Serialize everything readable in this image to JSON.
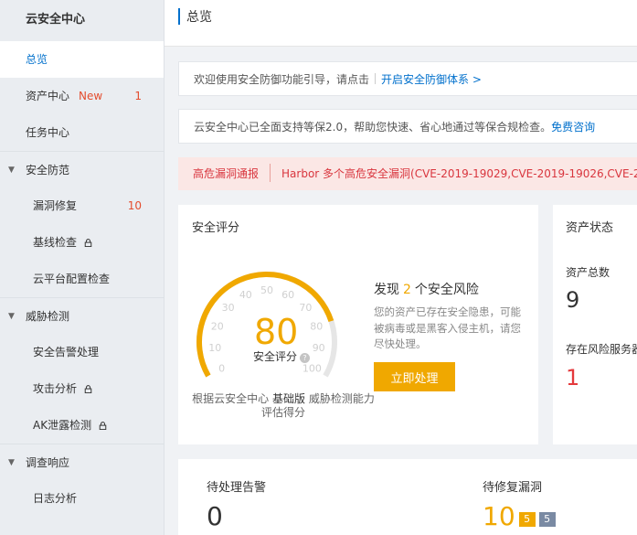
{
  "sidebar": {
    "title": "云安全中心",
    "items": [
      {
        "label": "总览"
      },
      {
        "label": "资产中心",
        "badge": "New",
        "count": "1"
      },
      {
        "label": "任务中心"
      }
    ],
    "groups": [
      {
        "label": "安全防范",
        "items": [
          {
            "label": "漏洞修复",
            "count": "10"
          },
          {
            "label": "基线检查",
            "locked": true
          },
          {
            "label": "云平台配置检查"
          }
        ]
      },
      {
        "label": "威胁检测",
        "items": [
          {
            "label": "安全告警处理"
          },
          {
            "label": "攻击分析",
            "locked": true
          },
          {
            "label": "AK泄露检测",
            "locked": true
          }
        ]
      },
      {
        "label": "调查响应",
        "items": [
          {
            "label": "日志分析"
          }
        ]
      }
    ]
  },
  "header": {
    "title": "总览"
  },
  "notices": {
    "guide_text": "欢迎使用安全防御功能引导，请点击",
    "guide_link": "开启安全防御体系 >",
    "compliance_text": "云安全中心已全面支持等保2.0，帮助您快速、省心地通过等保合规检查。",
    "compliance_link": "免费咨询"
  },
  "alert": {
    "tag": "高危漏洞通报",
    "text": "Harbor 多个高危安全漏洞(CVE-2019-19029,CVE-2019-19026,CVE-2019-"
  },
  "security_score": {
    "title": "安全评分",
    "score": "80",
    "score_label": "安全评分",
    "ticks": [
      "0",
      "10",
      "20",
      "30",
      "40",
      "50",
      "60",
      "70",
      "80",
      "90",
      "100"
    ],
    "desc_prefix": "根据云安全中心",
    "desc_edition": "基础版",
    "desc_suffix": "威胁检测能力",
    "desc_line2": "评估得分",
    "risk_prefix": "发现",
    "risk_count": "2",
    "risk_suffix": "个安全风险",
    "risk_desc": "您的资产已存在安全隐患，可能被病毒或是黑客入侵主机，请您尽快处理。",
    "action_label": "立即处理",
    "colors": {
      "accent": "#f0a800",
      "track": "#e6e6e6"
    }
  },
  "asset_status": {
    "title": "资产状态",
    "total_label": "资产总数",
    "total_value": "9",
    "risk_label": "存在风险服务器",
    "risk_value": "1",
    "colors": {
      "risk": "#e4393c"
    }
  },
  "bottom": {
    "alerts_label": "待处理告警",
    "alerts_value": "0",
    "vulns_label": "待修复漏洞",
    "vulns_value": "10",
    "vulns_high": "5",
    "vulns_medium": "5",
    "colors": {
      "high": "#f0a800",
      "medium": "#7a8aa3"
    }
  }
}
